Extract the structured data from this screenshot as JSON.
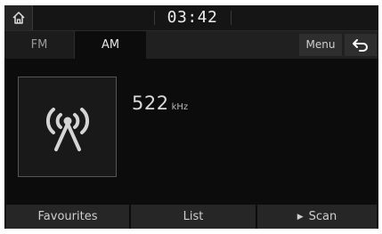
{
  "status_bar": {
    "time": "03:42",
    "home_icon": "home-icon"
  },
  "tabs": [
    {
      "label": "FM",
      "active": false
    },
    {
      "label": "AM",
      "active": true
    }
  ],
  "header_buttons": {
    "menu_label": "Menu",
    "back_icon": "back-arrow-icon"
  },
  "station": {
    "art_icon": "radio-tower-icon",
    "frequency": "522",
    "unit": "kHz"
  },
  "bottom_bar": {
    "favourites_label": "Favourites",
    "list_label": "List",
    "scan_label": "Scan",
    "scan_icon": "play-icon"
  },
  "colors": {
    "background": "#0c0c0c",
    "button": "#262626",
    "text": "#d9d9d9"
  }
}
